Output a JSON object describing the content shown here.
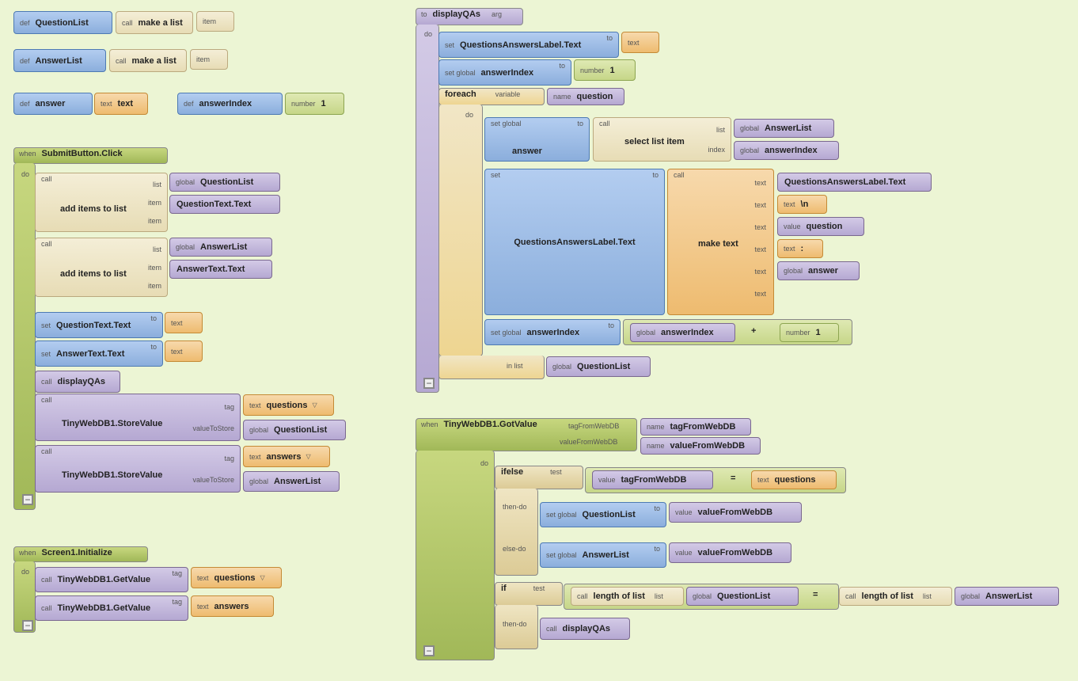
{
  "kw": {
    "def": "def",
    "call": "call",
    "item": "item",
    "text": "text",
    "number": "number",
    "to": "to",
    "arg": "arg",
    "when": "when",
    "do": "do",
    "list": "list",
    "set": "set",
    "setglobal": "set global",
    "global": "global",
    "tag": "tag",
    "valueToStore": "valueToStore",
    "foreach": "foreach",
    "variable": "variable",
    "name": "name",
    "index": "index",
    "value": "value",
    "inlist": "in list",
    "ifelse": "ifelse",
    "if": "if",
    "test": "test",
    "thendo": "then-do",
    "elsedo": "else-do",
    "tagFromWebDB": "tagFromWebDB",
    "valueFromWebDB": "valueFromWebDB"
  },
  "v": {
    "QuestionList": "QuestionList",
    "AnswerList": "AnswerList",
    "answer": "answer",
    "answerIndex": "answerIndex",
    "makealist": "make a list",
    "num1": "1",
    "SubmitButtonClick": "SubmitButton.Click",
    "additems": "add items to list",
    "QuestionTextText": "QuestionText.Text",
    "AnswerTextText": "AnswerText.Text",
    "displayQAs": "displayQAs",
    "TinyWebDB1StoreValue": "TinyWebDB1.StoreValue",
    "questions": "questions",
    "answers": "answers",
    "Screen1Initialize": "Screen1.Initialize",
    "TinyWebDB1GetValue": "TinyWebDB1.GetValue",
    "QALabelText": "QuestionsAnswersLabel.Text",
    "question": "question",
    "selectlistitem": "select list item",
    "maketext": "make text",
    "newline": "\\n",
    "colon": ":",
    "plus": "+",
    "TinyWebDB1GotValue": "TinyWebDB1.GotValue",
    "tagFromWebDB_v": "tagFromWebDB",
    "valueFromWebDB_v": "valueFromWebDB",
    "eq": "=",
    "lengthoflist": "length of list"
  },
  "chart_data": {
    "type": "table",
    "notes": "MIT App Inventor block diagram — block connections and attributes",
    "definitions": [
      {
        "kind": "def-variable",
        "name": "QuestionList",
        "init": {
          "call": "make a list",
          "items": []
        }
      },
      {
        "kind": "def-variable",
        "name": "AnswerList",
        "init": {
          "call": "make a list",
          "items": []
        }
      },
      {
        "kind": "def-variable",
        "name": "answer",
        "init": {
          "type": "text",
          "value": "text"
        }
      },
      {
        "kind": "def-variable",
        "name": "answerIndex",
        "init": {
          "type": "number",
          "value": 1
        }
      }
    ],
    "event_handlers": [
      {
        "when": "SubmitButton.Click",
        "do": [
          {
            "call": "add items to list",
            "list": {
              "global": "QuestionList"
            },
            "items": [
              "QuestionText.Text"
            ]
          },
          {
            "call": "add items to list",
            "list": {
              "global": "AnswerList"
            },
            "items": [
              "AnswerText.Text"
            ]
          },
          {
            "set": "QuestionText.Text",
            "to": {
              "type": "text",
              "value": ""
            }
          },
          {
            "set": "AnswerText.Text",
            "to": {
              "type": "text",
              "value": ""
            }
          },
          {
            "call": "displayQAs"
          },
          {
            "call": "TinyWebDB1.StoreValue",
            "tag": {
              "type": "text",
              "value": "questions"
            },
            "valueToStore": {
              "global": "QuestionList"
            }
          },
          {
            "call": "TinyWebDB1.StoreValue",
            "tag": {
              "type": "text",
              "value": "answers"
            },
            "valueToStore": {
              "global": "AnswerList"
            }
          }
        ]
      },
      {
        "when": "Screen1.Initialize",
        "do": [
          {
            "call": "TinyWebDB1.GetValue",
            "tag": {
              "type": "text",
              "value": "questions"
            }
          },
          {
            "call": "TinyWebDB1.GetValue",
            "tag": {
              "type": "text",
              "value": "answers"
            }
          }
        ]
      },
      {
        "when": "TinyWebDB1.GotValue",
        "args": [
          {
            "name": "tagFromWebDB"
          },
          {
            "name": "valueFromWebDB"
          }
        ],
        "do": [
          {
            "ifelse": {
              "test": {
                "op": "=",
                "left": {
                  "value": "tagFromWebDB"
                },
                "right": {
                  "type": "text",
                  "value": "questions"
                }
              },
              "then-do": [
                {
                  "set global": "QuestionList",
                  "to": {
                    "value": "valueFromWebDB"
                  }
                }
              ],
              "else-do": [
                {
                  "set global": "AnswerList",
                  "to": {
                    "value": "valueFromWebDB"
                  }
                }
              ]
            }
          },
          {
            "if": {
              "test": {
                "op": "=",
                "left": {
                  "call": "length of list",
                  "list": {
                    "global": "QuestionList"
                  }
                },
                "right": {
                  "call": "length of list",
                  "list": {
                    "global": "AnswerList"
                  }
                }
              },
              "then-do": [
                {
                  "call": "displayQAs"
                }
              ]
            }
          }
        ]
      }
    ],
    "procedures": [
      {
        "to": "displayQAs",
        "args": [],
        "do": [
          {
            "set": "QuestionsAnswersLabel.Text",
            "to": {
              "type": "text",
              "value": ""
            }
          },
          {
            "set global": "answerIndex",
            "to": {
              "type": "number",
              "value": 1
            }
          },
          {
            "foreach": {
              "variable": "question",
              "in list": {
                "global": "QuestionList"
              },
              "do": [
                {
                  "set global": "answer",
                  "to": {
                    "call": "select list item",
                    "list": {
                      "global": "AnswerList"
                    },
                    "index": {
                      "global": "answerIndex"
                    }
                  }
                },
                {
                  "set": "QuestionsAnswersLabel.Text",
                  "to": {
                    "call": "make text",
                    "text": [
                      "QuestionsAnswersLabel.Text",
                      {
                        "type": "text",
                        "value": "\\n"
                      },
                      {
                        "value": "question"
                      },
                      {
                        "type": "text",
                        "value": ":"
                      },
                      {
                        "global": "answer"
                      }
                    ]
                  }
                },
                {
                  "set global": "answerIndex",
                  "to": {
                    "op": "+",
                    "left": {
                      "global": "answerIndex"
                    },
                    "right": {
                      "type": "number",
                      "value": 1
                    }
                  }
                }
              ]
            }
          }
        ]
      }
    ]
  }
}
